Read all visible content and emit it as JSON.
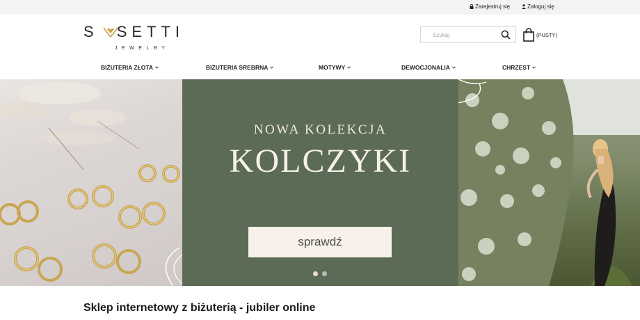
{
  "top_bar": {
    "register": {
      "label": "Zarejestruj się",
      "icon": "lock-icon"
    },
    "login": {
      "label": "Zaloguj się",
      "icon": "user-icon"
    }
  },
  "logo": {
    "wordmark": "S♥SETTI",
    "subtitle": "JEWELRY",
    "heart_color": "#c6a24a"
  },
  "search": {
    "placeholder": "Szukaj",
    "value": "",
    "icon": "search-icon"
  },
  "cart": {
    "label": "(PUSTY)",
    "icon": "shopping-bag-icon"
  },
  "nav": {
    "items": [
      {
        "label": "BIŻUTERIA ZŁOTA"
      },
      {
        "label": "BIŻUTERIA SREBRNA"
      },
      {
        "label": "MOTYWY"
      },
      {
        "label": "DEWOCJONALIA"
      },
      {
        "label": "CHRZEST"
      }
    ]
  },
  "hero": {
    "kicker": "NOWA KOLEKCJA",
    "headline": "KOLCZYKI",
    "cta_label": "sprawdź",
    "colors": {
      "panel": "#5b6b56",
      "text": "#f7f2e8",
      "button_bg": "#f8f1e9"
    },
    "slides": {
      "count": 2,
      "active": 1
    }
  },
  "page": {
    "heading": "Sklep internetowy z biżuterią - jubiler online"
  }
}
